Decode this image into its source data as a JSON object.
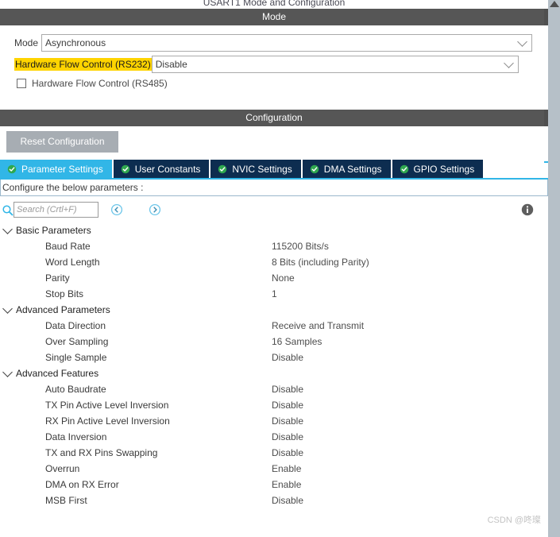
{
  "window": {
    "panel_title": "USART1 Mode and Configuration",
    "watermark": "CSDN @咚璨"
  },
  "mode_section": {
    "header": "Mode",
    "mode_label": "Mode",
    "mode_value": "Asynchronous",
    "hfc_rs232_label": "Hardware Flow Control (RS232)",
    "hfc_rs232_value": "Disable",
    "hfc_rs485_label": "Hardware Flow Control (RS485)",
    "hfc_rs485_checked": false,
    "highlight_color": "#ffd400"
  },
  "configuration_section": {
    "header": "Configuration",
    "reset_button": "Reset Configuration",
    "tabs": [
      {
        "label": "Parameter Settings",
        "active": true
      },
      {
        "label": "User Constants",
        "active": false
      },
      {
        "label": "NVIC Settings",
        "active": false
      },
      {
        "label": "DMA Settings",
        "active": false
      },
      {
        "label": "GPIO Settings",
        "active": false
      }
    ],
    "hint": "Configure the below parameters :",
    "search": {
      "placeholder": "Search (Crtl+F)",
      "value": ""
    },
    "groups": [
      {
        "name": "Basic Parameters",
        "expanded": true,
        "params": [
          {
            "name": "Baud Rate",
            "value": "115200 Bits/s"
          },
          {
            "name": "Word Length",
            "value": "8 Bits (including Parity)"
          },
          {
            "name": "Parity",
            "value": "None"
          },
          {
            "name": "Stop Bits",
            "value": "1"
          }
        ]
      },
      {
        "name": "Advanced Parameters",
        "expanded": true,
        "params": [
          {
            "name": "Data Direction",
            "value": "Receive and Transmit"
          },
          {
            "name": "Over Sampling",
            "value": "16 Samples"
          },
          {
            "name": "Single Sample",
            "value": "Disable"
          }
        ]
      },
      {
        "name": "Advanced Features",
        "expanded": true,
        "params": [
          {
            "name": "Auto Baudrate",
            "value": "Disable"
          },
          {
            "name": "TX Pin Active Level Inversion",
            "value": "Disable"
          },
          {
            "name": "RX Pin Active Level Inversion",
            "value": "Disable"
          },
          {
            "name": "Data Inversion",
            "value": "Disable"
          },
          {
            "name": "TX and RX Pins Swapping",
            "value": "Disable"
          },
          {
            "name": "Overrun",
            "value": "Enable"
          },
          {
            "name": "DMA on RX Error",
            "value": "Enable"
          },
          {
            "name": "MSB First",
            "value": "Disable"
          }
        ]
      }
    ]
  },
  "colors": {
    "section_bar": "#565656",
    "tab_active": "#31b6e7",
    "tab_inactive": "#0d2d50",
    "tab_check": "#2fa84f"
  }
}
